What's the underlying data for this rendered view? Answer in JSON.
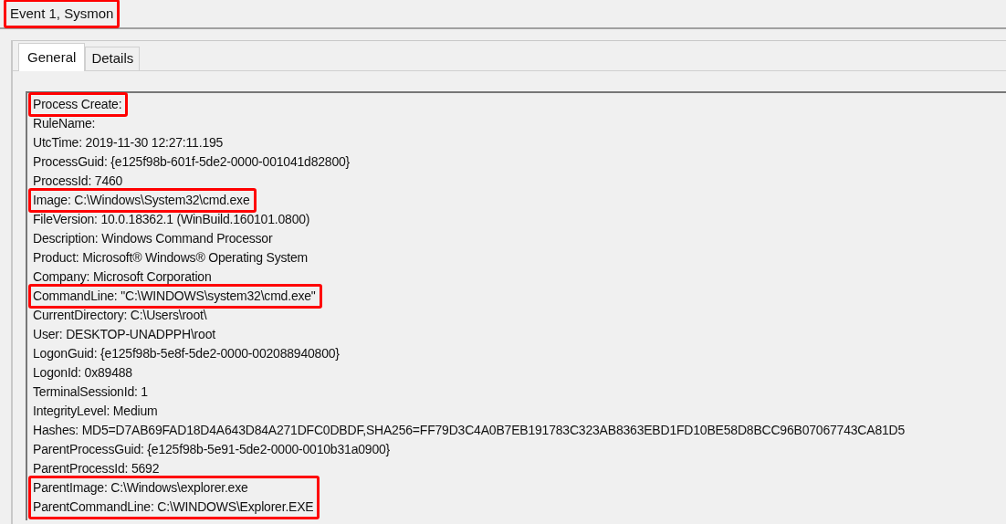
{
  "window": {
    "title": "Event 1, Sysmon",
    "title_highlighted": true
  },
  "tabs": [
    {
      "label": "General",
      "selected": true
    },
    {
      "label": "Details",
      "selected": false
    }
  ],
  "lines": [
    {
      "text": "Process Create:",
      "highlighted": true
    },
    {
      "text": "RuleName:",
      "highlighted": false
    },
    {
      "text": "UtcTime: 2019-11-30 12:27:11.195",
      "highlighted": false
    },
    {
      "text": "ProcessGuid: {e125f98b-601f-5de2-0000-001041d82800}",
      "highlighted": false
    },
    {
      "text": "ProcessId: 7460",
      "highlighted": false
    },
    {
      "text": "Image: C:\\Windows\\System32\\cmd.exe",
      "highlighted": true
    },
    {
      "text": "FileVersion: 10.0.18362.1 (WinBuild.160101.0800)",
      "highlighted": false
    },
    {
      "text": "Description: Windows Command Processor",
      "highlighted": false
    },
    {
      "text": "Product: Microsoft® Windows® Operating System",
      "highlighted": false
    },
    {
      "text": "Company: Microsoft Corporation",
      "highlighted": false
    },
    {
      "text": "CommandLine: \"C:\\WINDOWS\\system32\\cmd.exe\"",
      "highlighted": true
    },
    {
      "text": "CurrentDirectory: C:\\Users\\root\\",
      "highlighted": false
    },
    {
      "text": "User: DESKTOP-UNADPPH\\root",
      "highlighted": false
    },
    {
      "text": "LogonGuid: {e125f98b-5e8f-5de2-0000-002088940800}",
      "highlighted": false
    },
    {
      "text": "LogonId: 0x89488",
      "highlighted": false
    },
    {
      "text": "TerminalSessionId: 1",
      "highlighted": false
    },
    {
      "text": "IntegrityLevel: Medium",
      "highlighted": false
    },
    {
      "text": "Hashes: MD5=D7AB69FAD18D4A643D84A271DFC0DBDF,SHA256=FF79D3C4A0B7EB191783C323AB8363EBD1FD10BE58D8BCC96B07067743CA81D5",
      "highlighted": false
    },
    {
      "text": "ParentProcessGuid: {e125f98b-5e91-5de2-0000-0010b31a0900}",
      "highlighted": false
    },
    {
      "text": "ParentProcessId: 5692",
      "highlighted": false
    },
    {
      "text": "ParentImage: C:\\Windows\\explorer.exe",
      "highlighted": true
    },
    {
      "text": "ParentCommandLine: C:\\WINDOWS\\Explorer.EXE",
      "highlighted": true
    }
  ]
}
